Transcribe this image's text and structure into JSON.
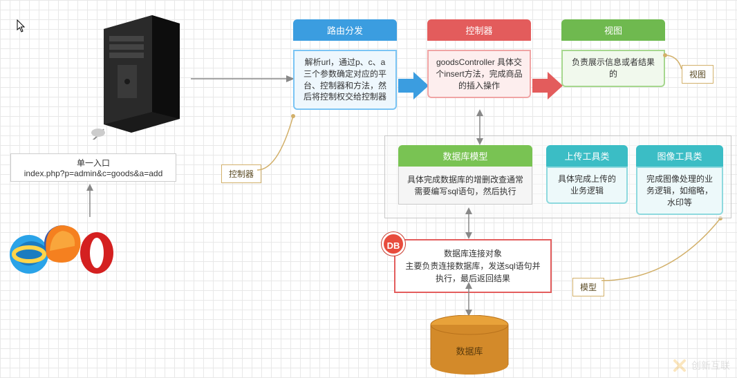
{
  "entry": {
    "title": "单一入口",
    "url": "index.php?p=admin&c=goods&a=add"
  },
  "router": {
    "title": "路由分发",
    "body": "解析url，通过p、c、a三个参数确定对应的平台、控制器和方法，然后将控制权交给控制器"
  },
  "controller": {
    "title": "控制器",
    "body": "goodsController 具体交个insert方法，完成商品的插入操作"
  },
  "view": {
    "title": "视图",
    "body": "负责展示信息或者结果的"
  },
  "model_group": {
    "db_model": {
      "title": "数据库模型",
      "body": "具体完成数据库的增删改查通常需要编写sql语句，然后执行"
    },
    "upload_tool": {
      "title": "上传工具类",
      "body": "具体完成上传的业务逻辑"
    },
    "image_tool": {
      "title": "图像工具类",
      "body": "完成图像处理的业务逻辑，如缩略，水印等"
    }
  },
  "db_conn": {
    "badge": "DB",
    "body": "数据库连接对象\n主要负责连接数据库，发送sql语句并执行，最后返回结果"
  },
  "database": {
    "label": "数据库"
  },
  "labels": {
    "controller": "控制器",
    "view": "视图",
    "model": "模型"
  },
  "watermark": "创新互联"
}
